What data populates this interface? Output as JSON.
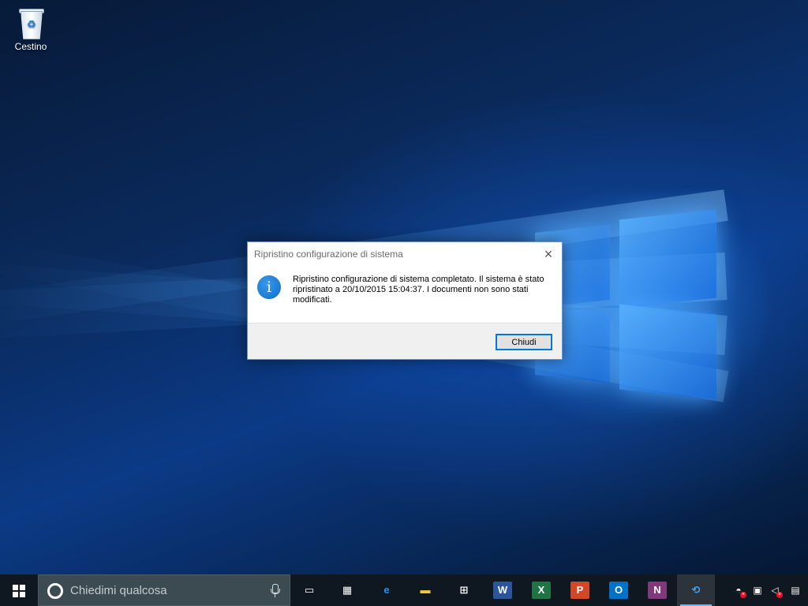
{
  "desktop": {
    "icons": [
      {
        "label": "Cestino",
        "icon": "recycle-bin-icon"
      }
    ]
  },
  "dialog": {
    "title": "Ripristino configurazione di sistema",
    "message": "Ripristino configurazione di sistema completato. Il sistema è stato ripristinato a 20/10/2015 15:04:37. I documenti non sono stati modificati.",
    "close_glyph": "×",
    "button_label": "Chiudi",
    "icon": "info-icon"
  },
  "taskbar": {
    "search_placeholder": "Chiedimi qualcosa",
    "pinned": [
      {
        "name": "task-view",
        "glyph": "▭"
      },
      {
        "name": "windows-store-tiles",
        "glyph": "▦"
      },
      {
        "name": "edge",
        "glyph": "e",
        "color": "#1e90ff"
      },
      {
        "name": "file-explorer",
        "glyph": "▬",
        "color": "#f6c343"
      },
      {
        "name": "store",
        "glyph": "⊞",
        "color": "#ffffff"
      },
      {
        "name": "word",
        "glyph": "W",
        "color": "#2b579a"
      },
      {
        "name": "excel",
        "glyph": "X",
        "color": "#217346"
      },
      {
        "name": "powerpoint",
        "glyph": "P",
        "color": "#d24726"
      },
      {
        "name": "outlook",
        "glyph": "O",
        "color": "#0072c6"
      },
      {
        "name": "onenote",
        "glyph": "N",
        "color": "#80397b"
      },
      {
        "name": "system-restore",
        "glyph": "⟲",
        "color": "#4aa3e8",
        "active": true
      }
    ],
    "tray": [
      {
        "name": "security-alert",
        "glyph": "◓"
      },
      {
        "name": "network",
        "glyph": "▣"
      },
      {
        "name": "volume",
        "glyph": "◁"
      },
      {
        "name": "action-center",
        "glyph": "▤"
      }
    ]
  }
}
